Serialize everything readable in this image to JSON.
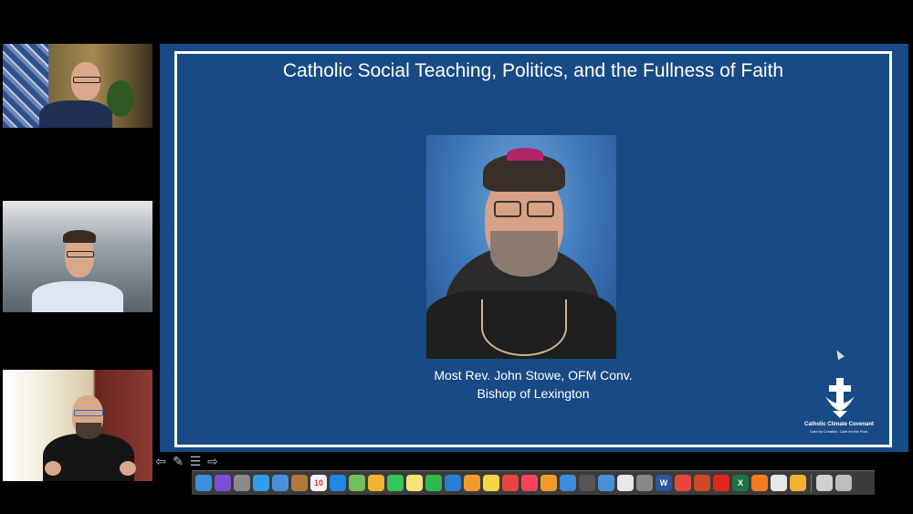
{
  "slide": {
    "title": "Catholic Social Teaching, Politics, and the Fullness of Faith",
    "caption_line1": "Most Rev. John Stowe, OFM Conv.",
    "caption_line2": "Bishop of Lexington",
    "logo_name": "Catholic Climate Covenant",
    "logo_tagline": "Care for Creation. Care for the Poor.",
    "background_color": "#184a85"
  },
  "controls": [
    {
      "name": "previous-slide",
      "glyph": "⇦"
    },
    {
      "name": "pen-tool",
      "glyph": "✎"
    },
    {
      "name": "slide-menu",
      "glyph": "☰"
    },
    {
      "name": "next-slide",
      "glyph": "⇨"
    }
  ],
  "dock": {
    "icons": [
      {
        "name": "finder-icon",
        "color": "#3d8fe0"
      },
      {
        "name": "siri-icon",
        "color": "#7b4ed8"
      },
      {
        "name": "launchpad-icon",
        "color": "#8a8a8a"
      },
      {
        "name": "safari-icon",
        "color": "#2f9de8"
      },
      {
        "name": "mail-icon",
        "color": "#4a90d9"
      },
      {
        "name": "notes-folder-icon",
        "color": "#b07a3a"
      },
      {
        "name": "calendar-icon",
        "color": "#f4f4f4",
        "label": "10"
      },
      {
        "name": "app-store-icon",
        "color": "#1e88e5"
      },
      {
        "name": "maps-icon",
        "color": "#6fbf5a"
      },
      {
        "name": "photos-icon",
        "color": "#f2b233"
      },
      {
        "name": "messages-icon",
        "color": "#34c759"
      },
      {
        "name": "notes-icon",
        "color": "#f6e27a"
      },
      {
        "name": "facetime-icon",
        "color": "#30b850"
      },
      {
        "name": "keynote-icon",
        "color": "#2a7fd4"
      },
      {
        "name": "pages-icon",
        "color": "#f29a2e"
      },
      {
        "name": "stickies-icon",
        "color": "#f5d547"
      },
      {
        "name": "news-icon",
        "color": "#e8453c"
      },
      {
        "name": "music-icon",
        "color": "#f5455c"
      },
      {
        "name": "books-icon",
        "color": "#f29a2e"
      },
      {
        "name": "preview-icon",
        "color": "#3b8ed8"
      },
      {
        "name": "screenshot-icon",
        "color": "#555555"
      },
      {
        "name": "chrome-remote-icon",
        "color": "#4a90d9"
      },
      {
        "name": "textedit-icon",
        "color": "#e8e8e8"
      },
      {
        "name": "image-capture-icon",
        "color": "#888888"
      },
      {
        "name": "word-icon",
        "color": "#2b579a",
        "label": "W"
      },
      {
        "name": "chrome-icon",
        "color": "#e8453c"
      },
      {
        "name": "powerpoint-icon",
        "color": "#d24726"
      },
      {
        "name": "acrobat-icon",
        "color": "#e0261b"
      },
      {
        "name": "excel-icon",
        "color": "#1f7244",
        "label": "X"
      },
      {
        "name": "firefox-icon",
        "color": "#f57c1f"
      },
      {
        "name": "scheduler-icon",
        "color": "#e8e8e8"
      },
      {
        "name": "flower-icon",
        "color": "#f2b233"
      },
      {
        "name": "downloads-icon",
        "color": "#cfcfcf"
      },
      {
        "name": "trash-icon",
        "color": "#bdbdbd"
      }
    ]
  }
}
